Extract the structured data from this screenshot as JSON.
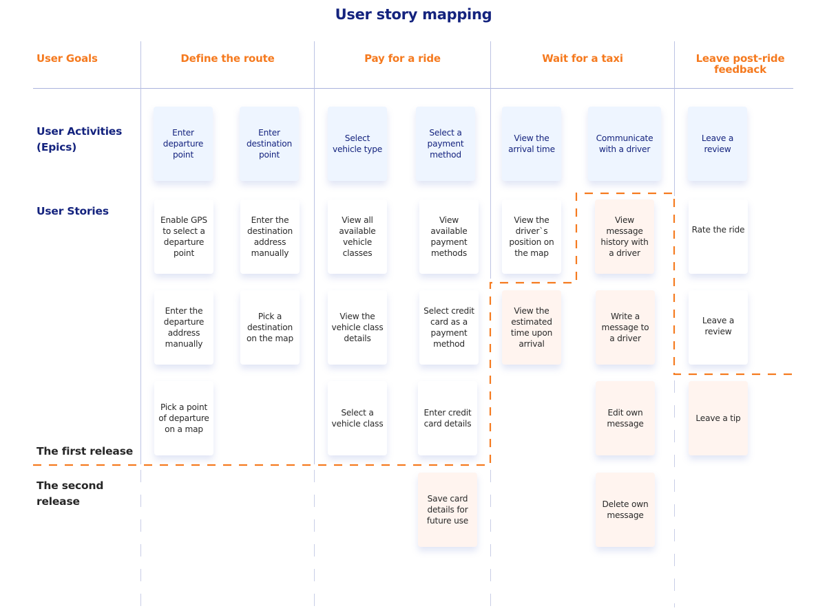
{
  "title": "User story mapping",
  "goals_header": "User Goals",
  "row_labels": {
    "activities": "User Activities (Epics)",
    "stories": "User Stories",
    "first_release": "The first release",
    "second_release": "The second release"
  },
  "goals": [
    {
      "label": "Define the route"
    },
    {
      "label": "Pay for a ride"
    },
    {
      "label": "Wait for a taxi"
    },
    {
      "label": "Leave post-ride feedback"
    }
  ],
  "epics": [
    {
      "label": "Enter departure point"
    },
    {
      "label": "Enter destination point"
    },
    {
      "label": "Select vehicle type"
    },
    {
      "label": "Select a payment method"
    },
    {
      "label": "View the arrival time"
    },
    {
      "label": "Communicate with a driver"
    },
    {
      "label": "Leave a review"
    }
  ],
  "stories": {
    "enter_departure": [
      "Enable GPS to select a departure point",
      "Enter the departure address manually",
      "Pick a point of departure on a map"
    ],
    "enter_destination": [
      "Enter the destination address manually",
      "Pick a destination on the map"
    ],
    "select_vehicle": [
      "View all available vehicle classes",
      "View the vehicle class details",
      "Select a vehicle class"
    ],
    "select_payment": [
      "View available payment methods",
      "Select credit card as a payment method",
      "Enter credit card details",
      "Save card details for future use"
    ],
    "arrival_time": [
      "View the driver`s position on the map",
      "View the estimated time upon arrival"
    ],
    "communicate": [
      "View message history with a driver",
      "Write a message to a driver",
      "Edit own message",
      "Delete own message"
    ],
    "review": [
      "Rate the ride",
      "Leave a review",
      "Leave a tip"
    ]
  },
  "colors": {
    "accent_orange": "#f57a1f",
    "navy": "#14237e",
    "epic_card": "#eef5ff",
    "story_card": "#ffffff",
    "later_release_card": "#fff4ef"
  }
}
